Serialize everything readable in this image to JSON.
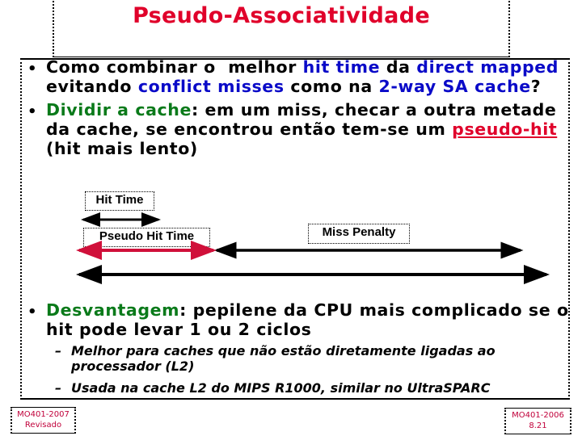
{
  "slide": {
    "title": "Pseudo-Associatividade",
    "bullets": [
      {
        "lines": [
          [
            {
              "t": "Como combinar o  melhor ",
              "c": "black"
            },
            {
              "t": "hit time",
              "c": "blue"
            },
            {
              "t": " da ",
              "c": "black"
            },
            {
              "t": "direct mapped",
              "c": "blue"
            }
          ],
          [
            {
              "t": "evitando ",
              "c": "black"
            },
            {
              "t": "conflict misses",
              "c": "blue"
            },
            {
              "t": " como na ",
              "c": "black"
            },
            {
              "t": "2-way SA cache",
              "c": "blue"
            },
            {
              "t": "?",
              "c": "black"
            }
          ]
        ]
      },
      {
        "lines": [
          [
            {
              "t": "Dividir a cache",
              "c": "green"
            },
            {
              "t": ": em um miss, checar a outra metade",
              "c": "black"
            }
          ],
          [
            {
              "t": "da cache, se encontrou então tem-se um ",
              "c": "black"
            },
            {
              "t": "pseudo-hit",
              "c": "red-u"
            }
          ],
          [
            {
              "t": "(hit mais lento)",
              "c": "black"
            }
          ]
        ]
      },
      {
        "lines": [
          [
            {
              "t": "Desvantagem",
              "c": "green"
            },
            {
              "t": ": pepilene da CPU mais complicado se o",
              "c": "black"
            }
          ],
          [
            {
              "t": "hit pode levar 1 ou 2 ciclos",
              "c": "black"
            }
          ]
        ]
      }
    ],
    "sub_bullets": [
      {
        "dash": "–",
        "lines": [
          "Melhor para caches que não estão diretamente ligadas ao",
          "processador (L2)"
        ]
      },
      {
        "dash": "–",
        "lines": [
          "Usada na cache L2 do MIPS R1000, similar no UltraSPARC"
        ]
      }
    ],
    "diagram": {
      "hit_time_label": "Hit Time",
      "pseudo_hit_time_label": "Pseudo Hit Time",
      "miss_penalty_label": "Miss Penalty",
      "colors": {
        "pseudo_hit_arrow": "#d0103a",
        "arrow": "#000000"
      }
    },
    "footer": {
      "left": [
        "MO401-2007",
        "Revisado"
      ],
      "right": [
        "MO401-2006",
        "8.21"
      ]
    },
    "colors": {
      "title": "#e0002a",
      "keyword_blue": "#0a0ac8",
      "keyword_green": "#0a7a1a",
      "footer_text": "#c0003a"
    }
  }
}
